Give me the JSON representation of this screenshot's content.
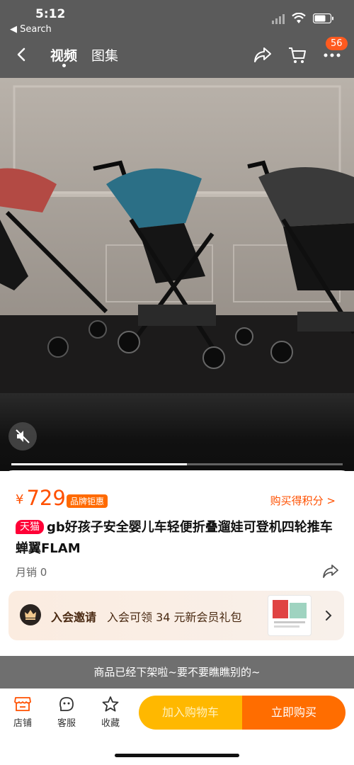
{
  "status_bar": {
    "time": "5:12",
    "back_label": "◀ Search"
  },
  "nav": {
    "back_icon": "chevron-left-icon",
    "tabs": [
      {
        "label": "视频",
        "active": true
      },
      {
        "label": "图集",
        "active": false
      }
    ],
    "more_badge": "56"
  },
  "media": {
    "progress_fraction": 0.53,
    "mute_icon": "muted-speaker-icon"
  },
  "product": {
    "currency": "¥",
    "price": "729",
    "brand_tag": "品牌钜惠",
    "points_link": "购买得积分 >",
    "store_tag": "天猫",
    "title": "gb好孩子安全婴儿车轻便折叠遛娃可登机四轮推车蝉翼FLAM",
    "sales": "月销 0"
  },
  "membership": {
    "title": "入会邀请",
    "desc": "入会可领 34 元新会员礼包"
  },
  "notice": "商品已经下架啦~要不要瞧瞧别的~",
  "bottom_bar": {
    "store": "店铺",
    "service": "客服",
    "favorite": "收藏",
    "add_cart": "加入购物车",
    "buy_now": "立即购买"
  },
  "colors": {
    "accent": "#ff5000",
    "tmall": "#ff0036",
    "cart_button": "#ffb800",
    "buy_button": "#ff6d00"
  }
}
